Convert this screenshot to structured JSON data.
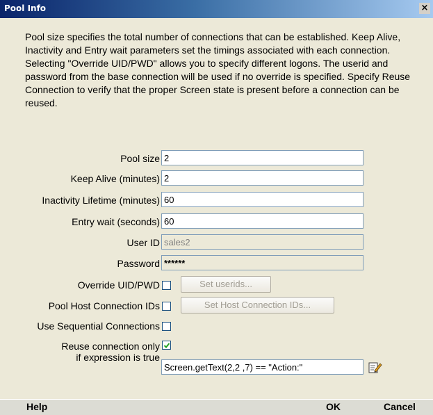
{
  "window": {
    "title": "Pool Info",
    "close_glyph": "×"
  },
  "description": "Pool size specifies the total number of connections that can be established.  Keep Alive, Inactivity and Entry wait parameters set the timings associated with each connection.  Selecting \"Override UID/PWD\" allows you to specify different logons. The userid and password from the base connection will be used if no override is specified. Specify Reuse Connection to verify that the proper Screen state is present before a connection can be reused.",
  "fields": {
    "pool_size": {
      "label": "Pool size",
      "value": "2"
    },
    "keep_alive": {
      "label": "Keep Alive (minutes)",
      "value": "2"
    },
    "inactivity_lifetime": {
      "label": "Inactivity Lifetime (minutes)",
      "value": "60"
    },
    "entry_wait": {
      "label": "Entry wait (seconds)",
      "value": "60"
    },
    "user_id": {
      "label": "User ID",
      "value": "sales2"
    },
    "password": {
      "label": "Password",
      "value": "******"
    }
  },
  "options": {
    "override_uid_pwd": {
      "label": "Override UID/PWD",
      "checked": false,
      "button_label": "Set userids..."
    },
    "pool_host_ids": {
      "label": "Pool Host Connection IDs",
      "checked": false,
      "button_label": "Set Host Connection IDs..."
    },
    "sequential": {
      "label": "Use Sequential Connections",
      "checked": false
    },
    "reuse": {
      "label_line1": "Reuse connection only",
      "label_line2": "if expression is true",
      "checked": true,
      "expression": "Screen.getText(2,2 ,7) == \"Action:\"",
      "edit_icon": "edit-expression-icon"
    }
  },
  "footer": {
    "help_label": "Help",
    "ok_label": "OK",
    "cancel_label": "Cancel"
  },
  "colors": {
    "dialog_bg": "#ece9d8",
    "title_start": "#0a246a",
    "title_end": "#a6caf0",
    "field_border": "#7f9db9"
  }
}
